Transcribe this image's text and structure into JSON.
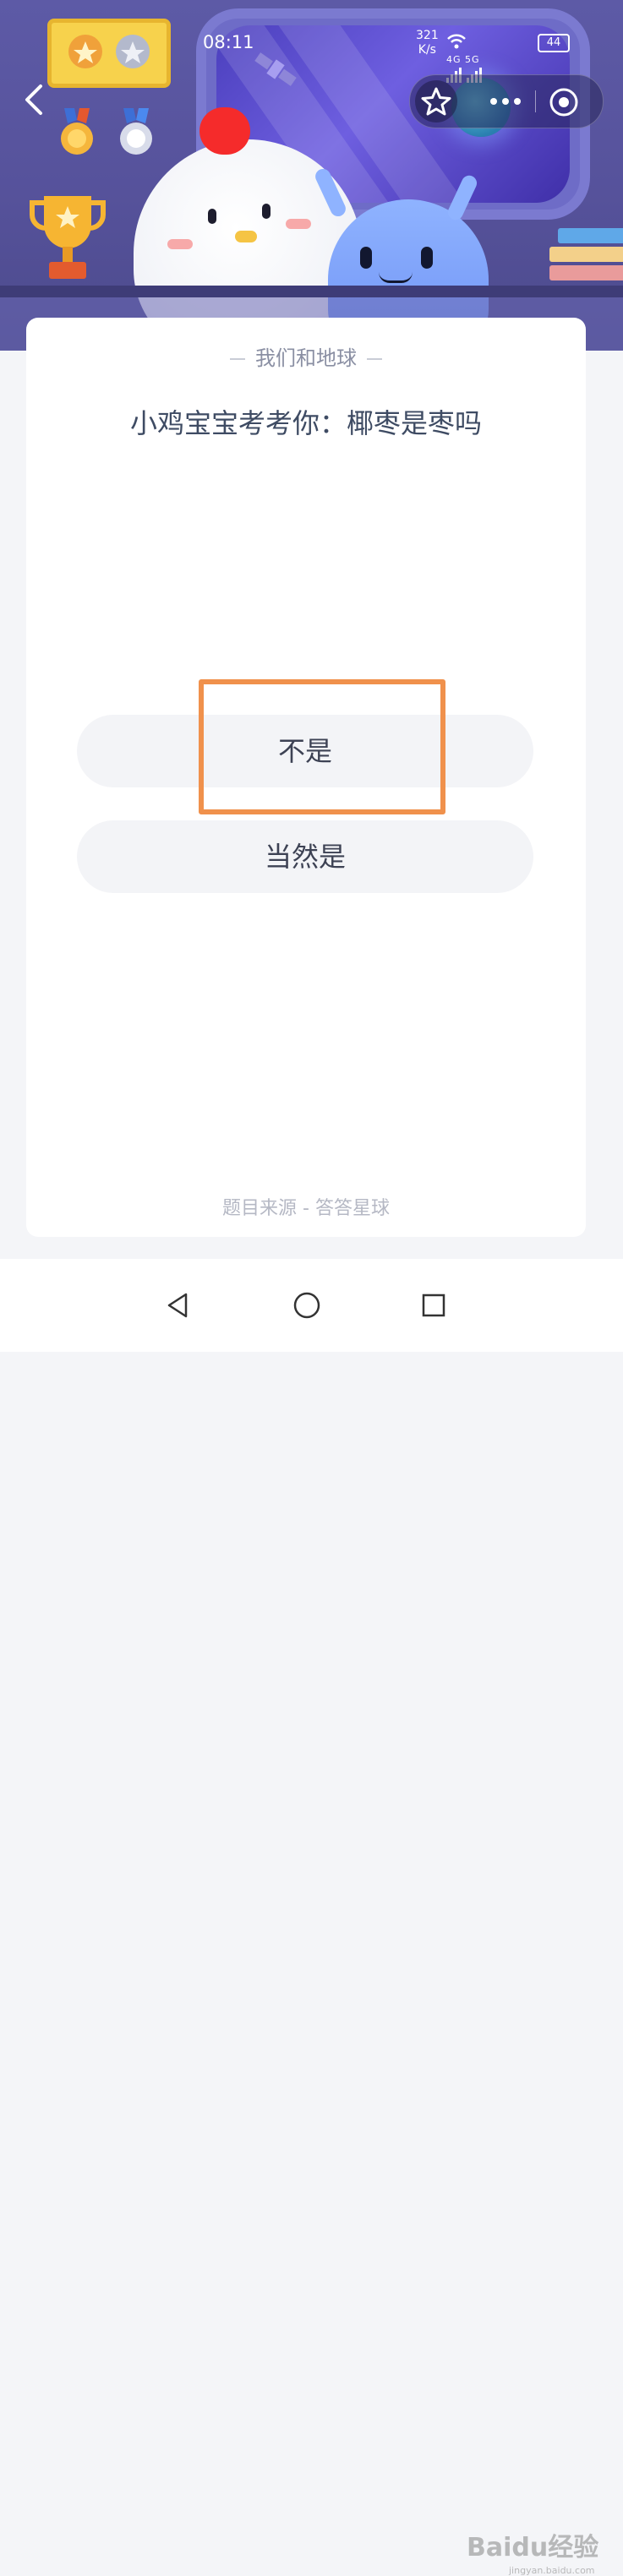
{
  "status_bar": {
    "time": "08:11",
    "net_speed_value": "321",
    "net_speed_unit": "K/s",
    "signal_text": "4G 5G",
    "battery": "44"
  },
  "quiz": {
    "section_title": "我们和地球",
    "question": "小鸡宝宝考考你：椰枣是枣吗",
    "options": [
      "不是",
      "当然是"
    ],
    "highlighted_option": "不是",
    "source": "题目来源 - 答答星球"
  },
  "watermark": {
    "brand": "Baidu经验",
    "url": "jingyan.baidu.com"
  },
  "colors": {
    "header_bg": "#5d5aa6",
    "card_bg": "#ffffff",
    "option_bg": "#f3f4f7",
    "highlight_border": "#f0914c",
    "question_text": "#3e4b63"
  }
}
